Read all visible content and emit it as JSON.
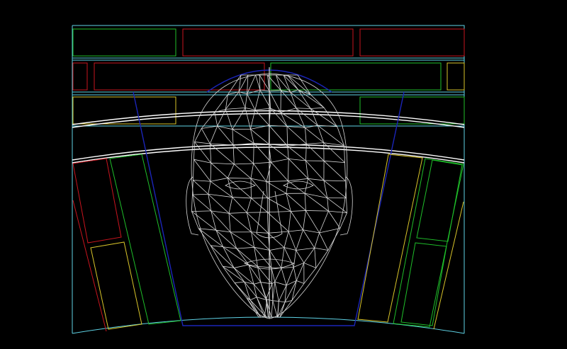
{
  "colors": {
    "background": "#000000",
    "frame": "#5fd3e6",
    "green": "#1fbf2a",
    "red": "#c8141e",
    "yellow": "#d9c52a",
    "blue": "#1b25b8",
    "white": "#ffffff",
    "mesh": "#d8d8d8"
  },
  "icons": {
    "face": "wireframe-head-mesh-icon"
  }
}
